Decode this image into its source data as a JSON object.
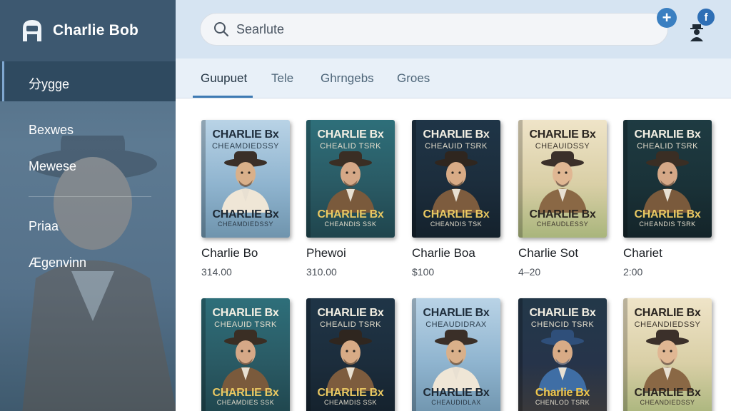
{
  "app": {
    "title": "Charlie Bob"
  },
  "sidebar": {
    "items": [
      {
        "label": "分ygge",
        "active": true
      },
      {
        "label": "Bexwes"
      },
      {
        "label": "Mewese"
      },
      {
        "label": "Priaa"
      },
      {
        "label": "Ægenvinn"
      }
    ]
  },
  "search": {
    "placeholder": "Searlute"
  },
  "header": {
    "notification_letter": "f"
  },
  "tabs": [
    {
      "label": "Guupuet",
      "active": true
    },
    {
      "label": "Tele"
    },
    {
      "label": "Ghrngebs"
    },
    {
      "label": "Groes"
    }
  ],
  "books": [
    {
      "title": "Charlie Bo",
      "price": "314.00",
      "cover_top": "CHARLIE Bx",
      "cover_sub": "CHEAMDIEDSSY",
      "cover_bottom": "CHARLIE Bx",
      "cover_bottom_sub": "CHEAMDIEDSSY",
      "palette": "blue-light"
    },
    {
      "title": "Phewoi",
      "price": "310.00",
      "cover_top": "CHARLIE Bx",
      "cover_sub": "CHEALID TSRK",
      "cover_bottom": "CHARLIE Bx",
      "cover_bottom_sub": "CHEANDIS SSK",
      "palette": "teal"
    },
    {
      "title": "Charlie Boa",
      "price": "$100",
      "cover_top": "CHARLIE Bx",
      "cover_sub": "CHEAUID TSRK",
      "cover_bottom": "CHARLIE Bx",
      "cover_bottom_sub": "CHEANDIS TSK",
      "palette": "navy"
    },
    {
      "title": "Charlie Sot",
      "price": "4–20",
      "cover_top": "CHARLIE Bx",
      "cover_sub": "CHEAUIDSSY",
      "cover_bottom": "CHARLIE Bx",
      "cover_bottom_sub": "CHEAUDLESSY",
      "palette": "cream"
    },
    {
      "title": "Chariet",
      "price": "2:00",
      "cover_top": "CHARLIE Bx",
      "cover_sub": "CHEALID TSRK",
      "cover_bottom": "CHARLIE Bx",
      "cover_bottom_sub": "CHEANDIS TSRK",
      "palette": "dark-teal"
    },
    {
      "title": "",
      "price": "",
      "cover_top": "CHARLIE Bx",
      "cover_sub": "CHEAUID TSRK",
      "cover_bottom": "CHARLIE Bx",
      "cover_bottom_sub": "CHEAMDIES SSK",
      "palette": "teal"
    },
    {
      "title": "",
      "price": "",
      "cover_top": "CHARLIE Bx",
      "cover_sub": "CHEALID TSRK",
      "cover_bottom": "CHARLIE Bx",
      "cover_bottom_sub": "CHEAMDIS SSK",
      "palette": "navy"
    },
    {
      "title": "",
      "price": "",
      "cover_top": "CHARLIE Bx",
      "cover_sub": "CHEAUDIDRAX",
      "cover_bottom": "CHARLIE Bx",
      "cover_bottom_sub": "CHEAUDIDLAX",
      "palette": "blue-light"
    },
    {
      "title": "",
      "price": "",
      "cover_top": "CHARLIE Bx",
      "cover_sub": "CHENCID TSRK",
      "cover_bottom": "Charlie Bx",
      "cover_bottom_sub": "CHENLOD TSRK",
      "palette": "dark-blue"
    },
    {
      "title": "",
      "price": "",
      "cover_top": "CHARLIE Bx",
      "cover_sub": "CHEANDIEDSSY",
      "cover_bottom": "CHARLIE Bx",
      "cover_bottom_sub": "CHEANDIEDSSY",
      "palette": "cream"
    }
  ],
  "colors": {
    "sidebar": "#4d6a82",
    "topbar": "#d6e4f2",
    "accent": "#3e7ab3"
  }
}
